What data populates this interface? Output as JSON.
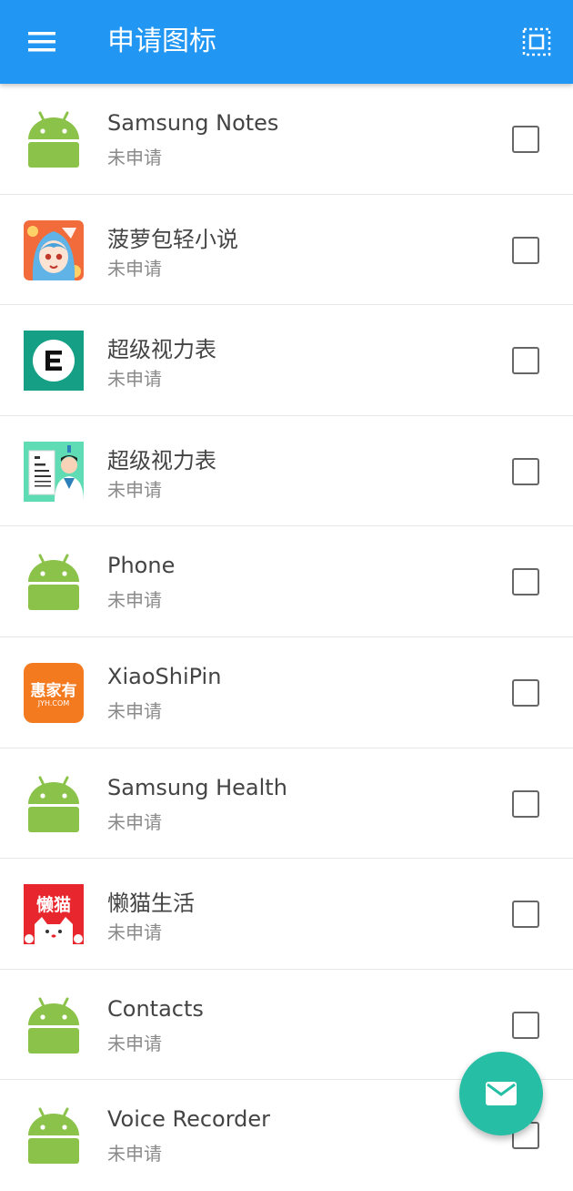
{
  "appbar": {
    "title": "申请图标",
    "menu_icon": "hamburger-menu-icon",
    "select_all_icon": "select-all-icon",
    "background": "#2196f3"
  },
  "apps": [
    {
      "name": "Samsung Notes",
      "status": "未申请",
      "icon": "android-robot-icon",
      "checked": false
    },
    {
      "name": "菠萝包轻小说",
      "status": "未申请",
      "icon": "anime-girl-app-icon",
      "checked": false
    },
    {
      "name": "超级视力表",
      "status": "未申请",
      "icon": "eye-chart-e-icon",
      "checked": false
    },
    {
      "name": "超级视力表",
      "status": "未申请",
      "icon": "eye-doctor-icon",
      "checked": false
    },
    {
      "name": "Phone",
      "status": "未申请",
      "icon": "android-robot-icon",
      "checked": false
    },
    {
      "name": "XiaoShiPin",
      "status": "未申请",
      "icon": "huijiayou-logo-icon",
      "checked": false
    },
    {
      "name": "Samsung Health",
      "status": "未申请",
      "icon": "android-robot-icon",
      "checked": false
    },
    {
      "name": "懒猫生活",
      "status": "未申请",
      "icon": "lazy-cat-logo-icon",
      "checked": false
    },
    {
      "name": "Contacts",
      "status": "未申请",
      "icon": "android-robot-icon",
      "checked": false
    },
    {
      "name": "Voice Recorder",
      "status": "未申请",
      "icon": "android-robot-icon",
      "checked": false
    }
  ],
  "logos": {
    "huijiayou_main": "惠家有",
    "huijiayou_sub": "JYH.COM",
    "lazycat_main": "懒猫"
  },
  "fab": {
    "icon": "mail-icon",
    "color": "#26bfa6"
  }
}
